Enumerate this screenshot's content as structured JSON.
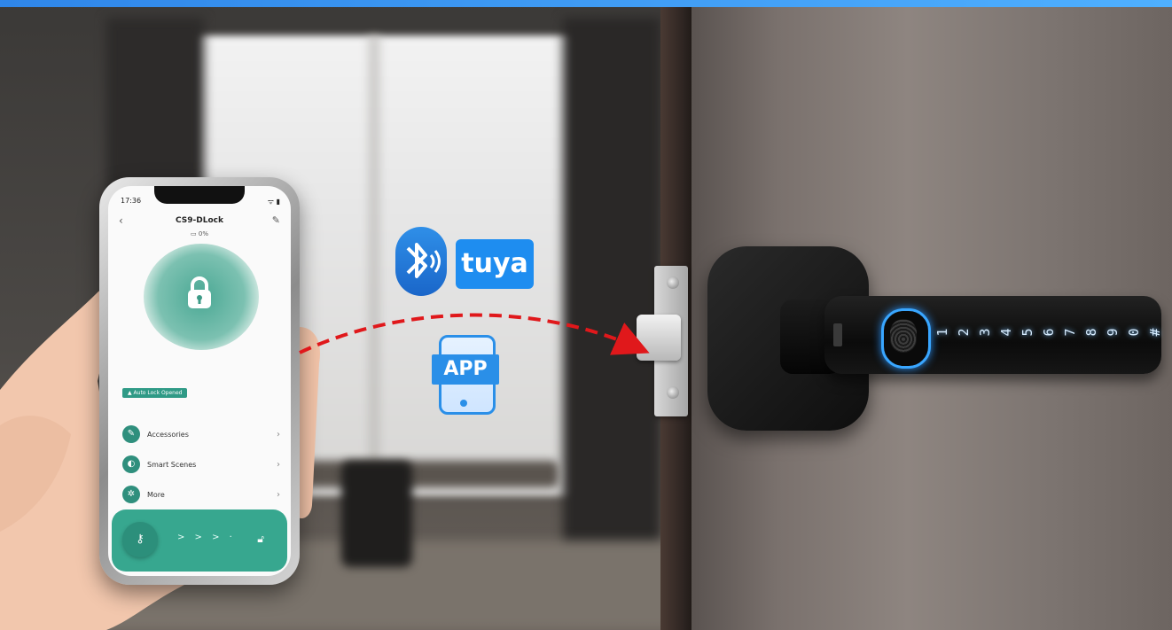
{
  "phone": {
    "status_time": "17:36",
    "status_icons": "ᯤ ▮",
    "device_name": "CS9-DLock",
    "battery": "0%",
    "back_icon": "chevron-left-icon",
    "edit_icon": "pencil-icon",
    "status_banner": "Auto Lock Opened",
    "menu": [
      {
        "label": "Accessories",
        "icon": "brush-icon"
      },
      {
        "label": "Smart Scenes",
        "icon": "toggle-icon"
      },
      {
        "label": "More",
        "icon": "gear-icon"
      }
    ],
    "slider_arrows": "> > > ·",
    "accent_color": "#37a78f"
  },
  "badges": {
    "tuya": "tuya",
    "app": "APP",
    "bluetooth_icon": "bluetooth-icon"
  },
  "keypad": [
    "1",
    "2",
    "3",
    "4",
    "5",
    "6",
    "7",
    "8",
    "9",
    "0",
    "#"
  ]
}
